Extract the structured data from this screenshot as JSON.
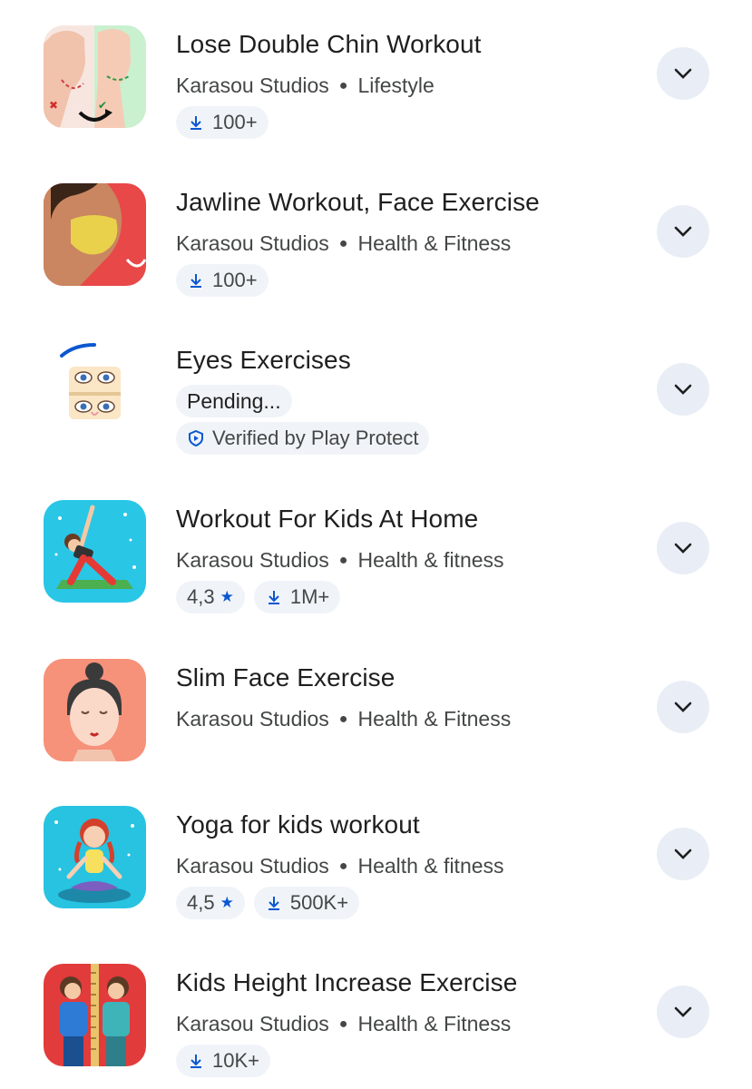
{
  "apps": [
    {
      "title": "Lose Double Chin Workout",
      "developer": "Karasou Studios",
      "category": "Lifestyle",
      "downloads": "100+",
      "icon": "double-chin-face-icon"
    },
    {
      "title": "Jawline Workout, Face Exercise",
      "developer": "Karasou Studios",
      "category": "Health & Fitness",
      "downloads": "100+",
      "icon": "jawline-man-icon"
    },
    {
      "title": "Eyes Exercises",
      "status": "Pending...",
      "protect": "Verified by Play Protect",
      "icon": "eyes-exercise-icon"
    },
    {
      "title": "Workout For Kids At Home",
      "developer": "Karasou Studios",
      "category": "Health & fitness",
      "rating": "4,3",
      "downloads": "1M+",
      "icon": "kids-workout-icon"
    },
    {
      "title": "Slim Face Exercise",
      "developer": "Karasou Studios",
      "category": "Health & Fitness",
      "icon": "slim-face-woman-icon"
    },
    {
      "title": "Yoga for kids workout",
      "developer": "Karasou Studios",
      "category": "Health & fitness",
      "rating": "4,5",
      "downloads": "500K+",
      "icon": "kids-yoga-girl-icon"
    },
    {
      "title": "Kids Height Increase Exercise",
      "developer": "Karasou Studios",
      "category": "Health & Fitness",
      "downloads": "10K+",
      "icon": "kids-height-measure-icon"
    }
  ],
  "colors": {
    "chip_bg": "#f0f4f9",
    "accent": "#0b57d0",
    "expand_bg": "#e9eef6",
    "title": "#1f1f1f",
    "secondary": "#444746"
  },
  "icons": {
    "download": "download-icon",
    "star": "star-icon",
    "shield": "play-protect-shield-icon",
    "chevron": "chevron-down-icon"
  }
}
